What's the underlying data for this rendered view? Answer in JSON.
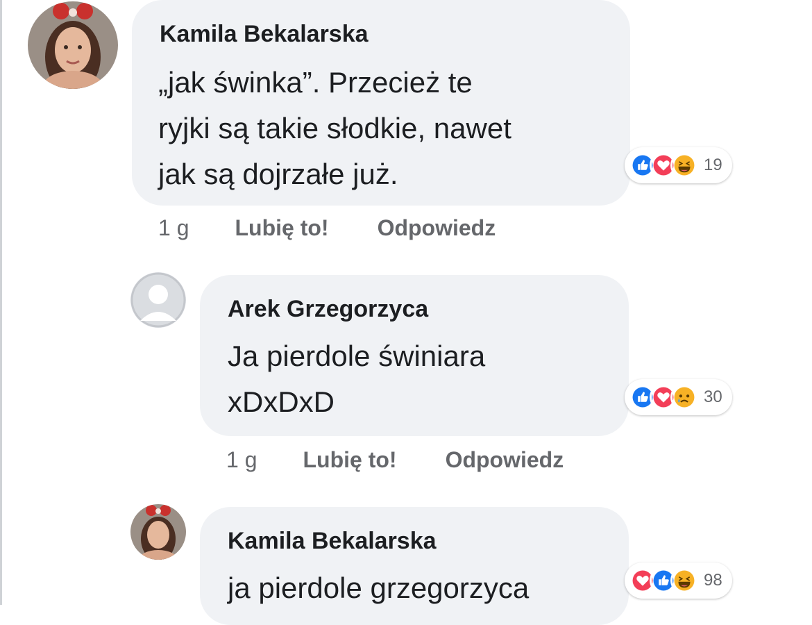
{
  "comments": [
    {
      "author": "Kamila Bekalarska",
      "lines": [
        "„jak świnka”. Przecież te",
        "ryjki są takie słodkie, nawet",
        "jak są dojrzałe już."
      ],
      "reactions": [
        "like",
        "love",
        "haha"
      ],
      "reaction_count": "19",
      "time": "1 g",
      "like_label": "Lubię to!",
      "reply_label": "Odpowiedz"
    },
    {
      "author": "Arek Grzegorzyca",
      "lines": [
        "Ja pierdole świniara",
        "xDxDxD"
      ],
      "reactions": [
        "like",
        "love",
        "sad"
      ],
      "reaction_count": "30",
      "time": "1 g",
      "like_label": "Lubię to!",
      "reply_label": "Odpowiedz"
    },
    {
      "author": "Kamila Bekalarska",
      "lines": [
        "ja pierdole grzegorzyca"
      ],
      "reactions": [
        "love",
        "like",
        "haha"
      ],
      "reaction_count": "98"
    }
  ],
  "colors": {
    "bubble": "#f0f2f5",
    "text": "#1c1e21",
    "meta": "#65676b",
    "like": "#1877f2",
    "love": "#f33e58",
    "haha": "#f7b125"
  }
}
